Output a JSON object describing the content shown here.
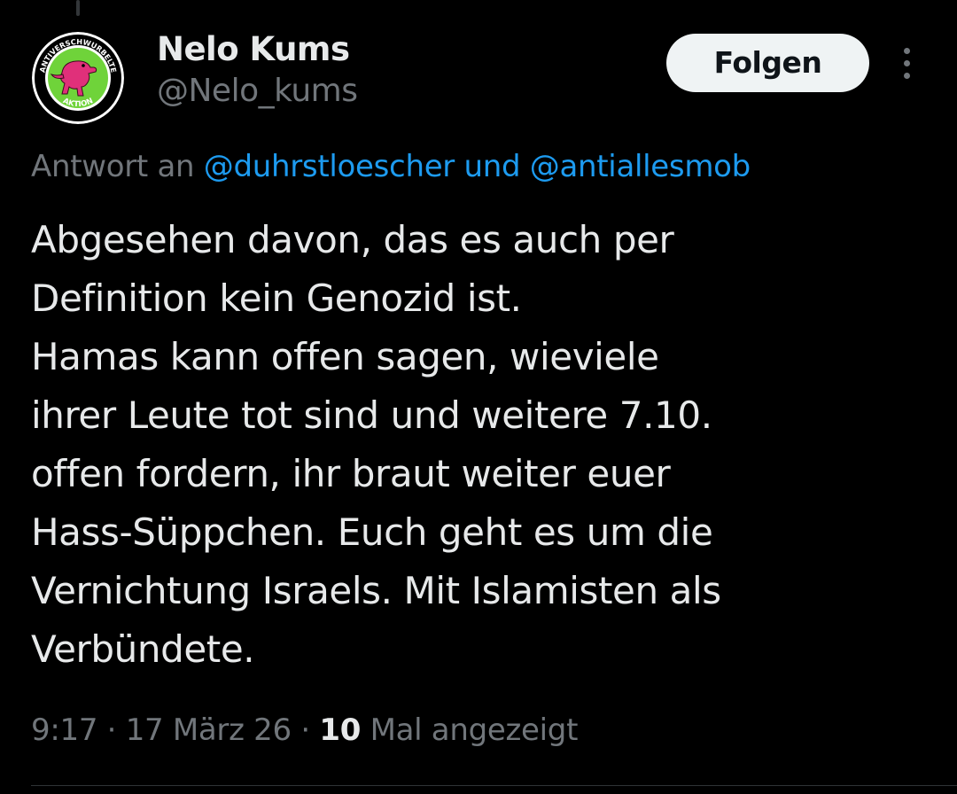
{
  "author": {
    "display_name": "Nelo Kums",
    "handle": "@Nelo_kums",
    "avatar": {
      "description_icon": "dinosaur-logo-icon",
      "ring_text_top": "ANTIVERSCHWURBELTE",
      "ring_text_bottom": "AKTION",
      "colors": {
        "ring": "#ffffff",
        "inner": "#6fd33a",
        "dino": "#e0307a"
      }
    }
  },
  "actions": {
    "follow_label": "Folgen",
    "more_icon": "more-vertical-icon"
  },
  "reply": {
    "prefix": "Antwort an ",
    "mention_1": "@duhrstloescher",
    "conjunction": " und ",
    "mention_2": "@antiallesmob"
  },
  "tweet": {
    "text": "Abgesehen davon, das es auch per\nDefinition kein Genozid ist.\nHamas kann offen sagen, wieviele\nihrer Leute tot sind und weitere 7.10.\noffen fordern, ihr braut weiter euer\nHass-Süppchen. Euch geht es um die\nVernichtung Israels. Mit Islamisten als\nVerbündete."
  },
  "meta": {
    "time": "9:17",
    "separator_1": " · ",
    "date": "17 März 26",
    "separator_2": " · ",
    "views_count": "10",
    "views_label": " Mal angezeigt"
  },
  "colors": {
    "background": "#000000",
    "text_primary": "#e7e9ea",
    "text_secondary": "#71767b",
    "link": "#1d9bf0",
    "button_bg": "#eff3f4",
    "divider": "#2f3336"
  }
}
